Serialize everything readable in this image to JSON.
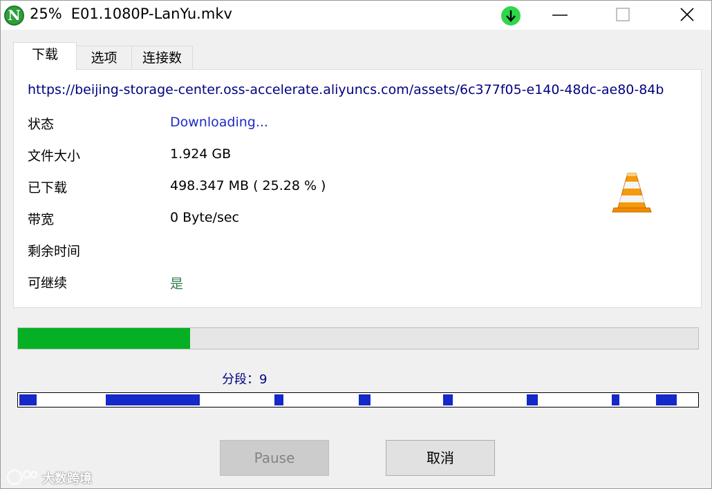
{
  "window": {
    "percent": "25%",
    "filename": "E01.1080P-LanYu.mkv",
    "app_icon_letter": "N",
    "icons": {
      "app": "app-n-logo-icon",
      "download_indicator": "download-arrow-icon",
      "minimize": "minimize-icon",
      "maximize": "maximize-icon",
      "close": "close-icon",
      "file_type": "vlc-cone-icon",
      "watermark": "watermark-logo-icon"
    }
  },
  "tabs": [
    {
      "label": "下载",
      "active": true
    },
    {
      "label": "选项",
      "active": false
    },
    {
      "label": "连接数",
      "active": false
    }
  ],
  "download": {
    "url": "https://beijing-storage-center.oss-accelerate.aliyuncs.com/assets/6c377f05-e140-48dc-ae80-84b",
    "rows": [
      {
        "label": "状态",
        "value": "Downloading..."
      },
      {
        "label": "文件大小",
        "value": "1.924 GB"
      },
      {
        "label": "已下载",
        "value": "498.347 MB ( 25.28 % )"
      },
      {
        "label": "带宽",
        "value": "0 Byte/sec"
      },
      {
        "label": "剩余时间",
        "value": ""
      },
      {
        "label": "可继续",
        "value": "是"
      }
    ]
  },
  "progress": {
    "fraction": 0.2528,
    "color": "#06b025"
  },
  "segments": {
    "label": "分段：9",
    "color": "#1528c8",
    "filled_ranges": [
      [
        0.0,
        0.025
      ],
      [
        0.128,
        0.266
      ],
      [
        0.377,
        0.39
      ],
      [
        0.501,
        0.518
      ],
      [
        0.625,
        0.64
      ],
      [
        0.749,
        0.765
      ],
      [
        0.874,
        0.886
      ],
      [
        0.94,
        0.97
      ]
    ]
  },
  "buttons": {
    "pause": "Pause",
    "cancel": "取消"
  },
  "watermark": {
    "text": "大数跨境"
  },
  "colors": {
    "status_text": "#1b2bc8",
    "resume_text": "#2e7d4a",
    "url_text": "#000080"
  }
}
